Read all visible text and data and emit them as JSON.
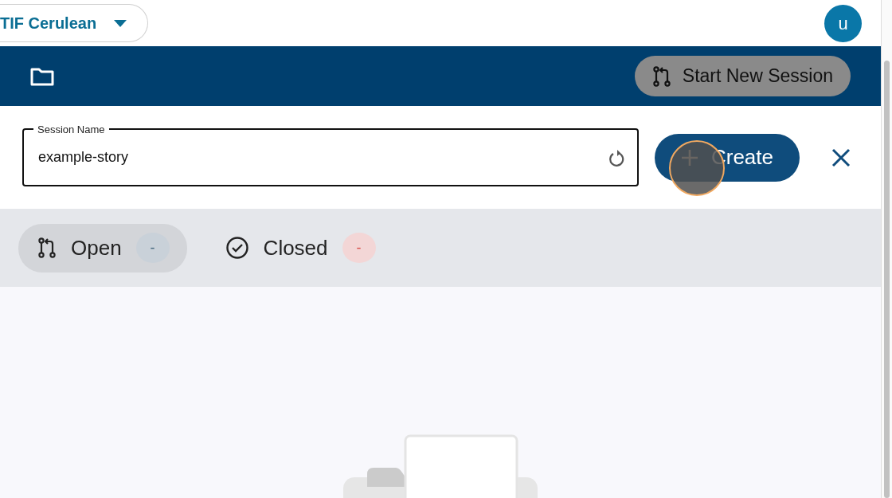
{
  "project_switcher": {
    "label": "TIF Cerulean"
  },
  "user": {
    "initial": "u"
  },
  "toolbar": {
    "start_button": "Start New Session"
  },
  "session_form": {
    "label": "Session Name",
    "value": "example-story",
    "create_button": "Create"
  },
  "tabs": [
    {
      "kind": "open",
      "label": "Open",
      "count": "-",
      "selected": true,
      "color": "#c9d1d9"
    },
    {
      "kind": "closed",
      "label": "Closed",
      "count": "-",
      "selected": false,
      "color": "#f3d6d6"
    }
  ]
}
